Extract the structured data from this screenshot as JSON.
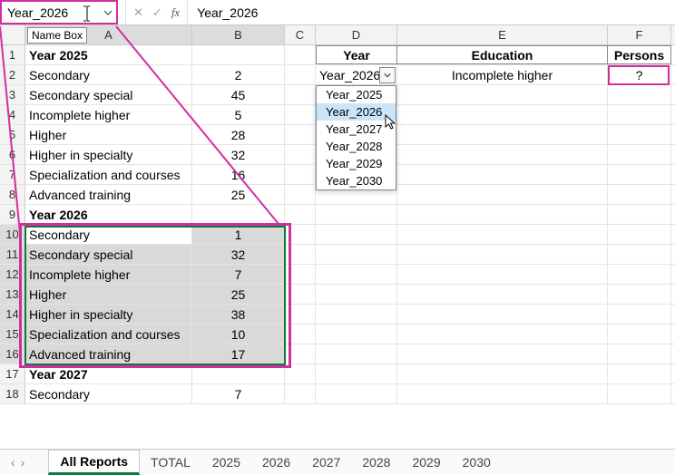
{
  "namebox": {
    "value": "Year_2026",
    "tooltip": "Name Box"
  },
  "formula": "Year_2026",
  "fb": {
    "cancel": "✕",
    "enter": "✓",
    "fx": "fx"
  },
  "columns": [
    "A",
    "B",
    "C",
    "D",
    "E",
    "F"
  ],
  "rows_data": [
    {
      "a": "Year 2025",
      "b": "",
      "bold": true
    },
    {
      "a": "Secondary",
      "b": "2"
    },
    {
      "a": "Secondary special",
      "b": "45"
    },
    {
      "a": "Incomplete higher",
      "b": "5"
    },
    {
      "a": "Higher",
      "b": "28"
    },
    {
      "a": "Higher in specialty",
      "b": "32"
    },
    {
      "a": "Specialization and courses",
      "b": "16"
    },
    {
      "a": "Advanced training",
      "b": "25"
    },
    {
      "a": "Year 2026",
      "b": "",
      "bold": true
    },
    {
      "a": "Secondary",
      "b": "1"
    },
    {
      "a": "Secondary special",
      "b": "32"
    },
    {
      "a": "Incomplete higher",
      "b": "7"
    },
    {
      "a": "Higher",
      "b": "25"
    },
    {
      "a": "Higher in specialty",
      "b": "38"
    },
    {
      "a": "Specialization and courses",
      "b": "10"
    },
    {
      "a": "Advanced training",
      "b": "17"
    },
    {
      "a": "Year 2027",
      "b": "",
      "bold": true
    },
    {
      "a": "Secondary",
      "b": "7"
    }
  ],
  "lookup": {
    "header_year": "Year",
    "header_edu": "Education",
    "header_persons": "Persons",
    "year_value": "Year_2026",
    "edu_value": "Incomplete higher",
    "persons_value": "?"
  },
  "dropdown": {
    "items": [
      "Year_2025",
      "Year_2026",
      "Year_2027",
      "Year_2028",
      "Year_2029",
      "Year_2030"
    ],
    "highlighted": 1
  },
  "tabs": {
    "active": "All Reports",
    "list": [
      "All Reports",
      "TOTAL",
      "2025",
      "2026",
      "2027",
      "2028",
      "2029",
      "2030"
    ]
  },
  "tabnav": {
    "prev": "‹",
    "next": "›"
  }
}
